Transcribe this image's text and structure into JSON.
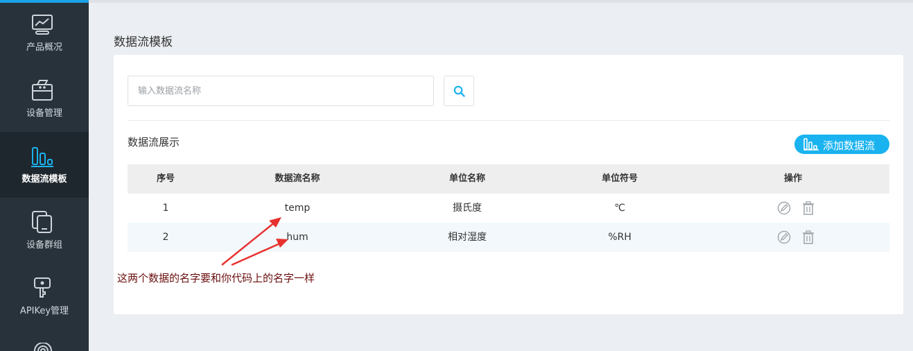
{
  "sidebar": {
    "items": [
      {
        "label": "产品概况",
        "icon": "chart-monitor-icon"
      },
      {
        "label": "设备管理",
        "icon": "device-icon"
      },
      {
        "label": "数据流模板",
        "icon": "bars-icon",
        "active": true
      },
      {
        "label": "设备群组",
        "icon": "group-icon"
      },
      {
        "label": "APIKey管理",
        "icon": "key-icon"
      }
    ]
  },
  "page": {
    "title": "数据流模板"
  },
  "search": {
    "placeholder": "输入数据流名称"
  },
  "section": {
    "title": "数据流展示",
    "add_label": "添加数据流"
  },
  "table": {
    "headers": [
      "序号",
      "数据流名称",
      "单位名称",
      "单位符号",
      "操作"
    ],
    "rows": [
      {
        "index": "1",
        "name": "temp",
        "unit_name": "摄氏度",
        "unit_symbol": "℃"
      },
      {
        "index": "2",
        "name": "hum",
        "unit_name": "相对湿度",
        "unit_symbol": "%RH"
      }
    ]
  },
  "annotation": {
    "text": "这两个数据的名字要和你代码上的名字一样",
    "color": "#e8312f"
  },
  "colors": {
    "accent": "#1ab3f0",
    "sidebar": "#28323b"
  }
}
